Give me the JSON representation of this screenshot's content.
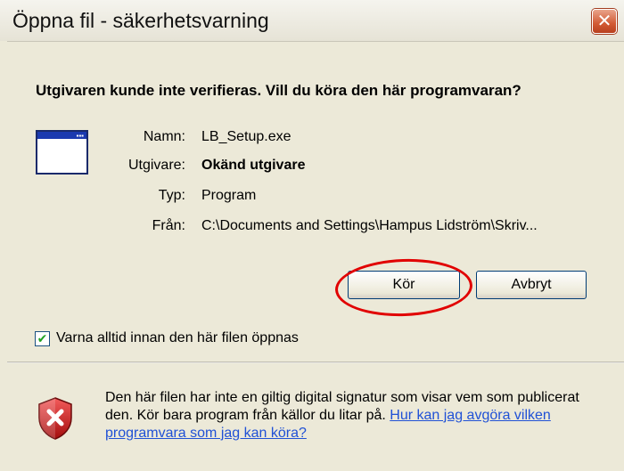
{
  "window": {
    "title": "Öppna fil - säkerhetsvarning",
    "close_glyph": "✕"
  },
  "headline": "Utgivaren kunde inte verifieras. Vill du köra den här programvaran?",
  "app_icon": "program-window-icon",
  "details": {
    "name_label": "Namn:",
    "name_value": "LB_Setup.exe",
    "publisher_label": "Utgivare:",
    "publisher_value": "Okänd utgivare",
    "type_label": "Typ:",
    "type_value": "Program",
    "from_label": "Från:",
    "from_value": "C:\\Documents and Settings\\Hampus Lidström\\Skriv..."
  },
  "buttons": {
    "run_label": "Kör",
    "cancel_label": "Avbryt"
  },
  "checkbox": {
    "checked": true,
    "check_glyph": "✔",
    "label": "Varna alltid innan den här filen öppnas"
  },
  "warning": {
    "icon": "shield-error-icon",
    "text": "Den här filen har inte en giltig digital signatur som visar vem som publicerat den. Kör bara program från källor du litar på.",
    "link_text": "Hur kan jag avgöra vilken programvara som jag kan köra?"
  },
  "colors": {
    "highlight": "#e10000",
    "link": "#2051d6"
  }
}
